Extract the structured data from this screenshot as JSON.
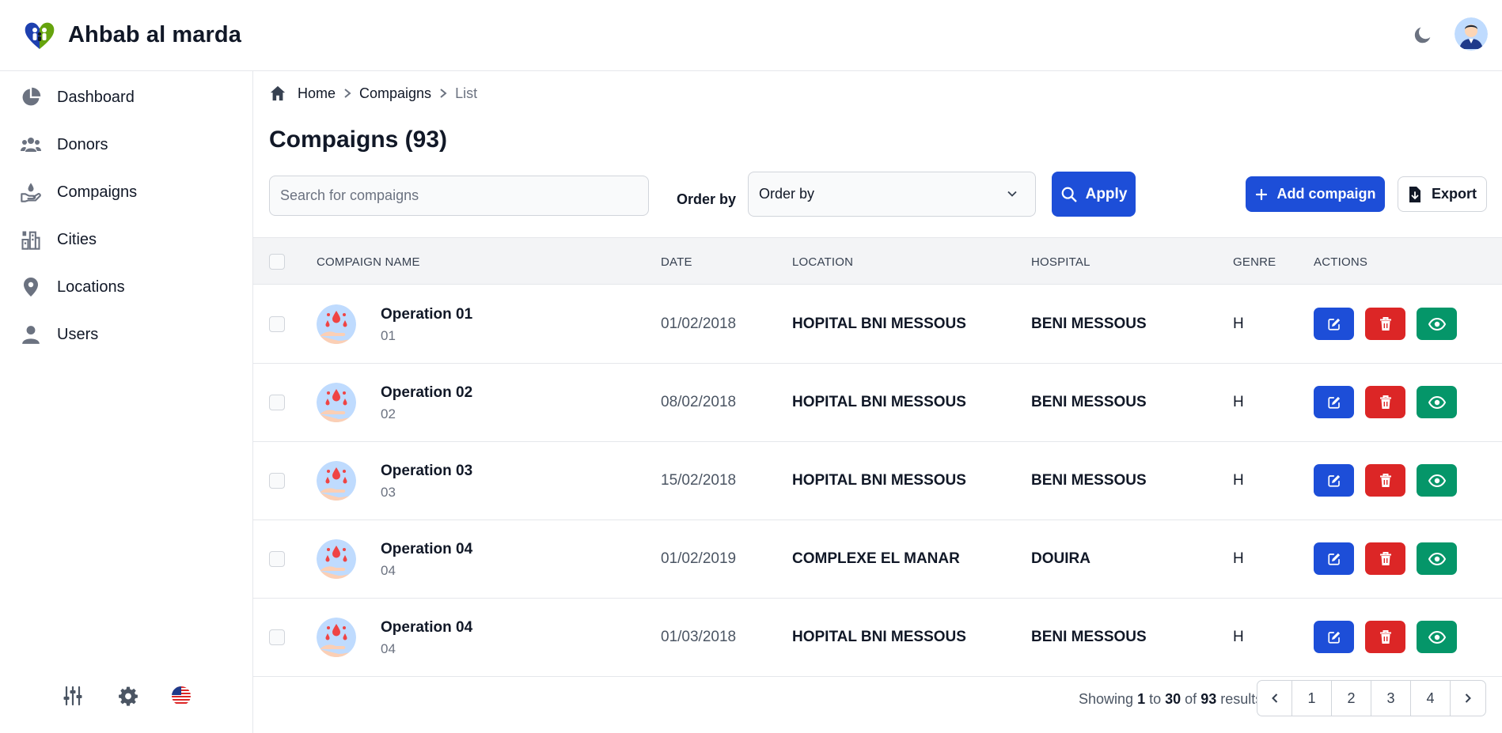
{
  "header": {
    "app_name": "Ahbab al marda"
  },
  "sidebar": {
    "items": [
      {
        "label": "Dashboard",
        "icon": "chart-pie-icon"
      },
      {
        "label": "Donors",
        "icon": "users-group-icon"
      },
      {
        "label": "Compaigns",
        "icon": "hand-drop-icon"
      },
      {
        "label": "Cities",
        "icon": "buildings-icon"
      },
      {
        "label": "Locations",
        "icon": "map-pin-icon"
      },
      {
        "label": "Users",
        "icon": "user-icon"
      }
    ],
    "bottom_icons": [
      "sliders-icon",
      "gear-icon",
      "us-flag-icon"
    ]
  },
  "breadcrumb": {
    "home": "Home",
    "section": "Compaigns",
    "current": "List"
  },
  "page": {
    "title": "Compaigns (93)"
  },
  "toolbar": {
    "search_placeholder": "Search for compaigns",
    "order_label": "Order by",
    "order_value": "Order by",
    "apply_label": "Apply",
    "add_label": "Add compaign",
    "export_label": "Export"
  },
  "table": {
    "headers": {
      "name": "COMPAIGN NAME",
      "date": "DATE",
      "location": "LOCATION",
      "hospital": "HOSPITAL",
      "genre": "GENRE",
      "actions": "ACTIONS"
    },
    "rows": [
      {
        "name": "Operation 01",
        "code": "01",
        "date": "01/02/2018",
        "location": "HOPITAL BNI MESSOUS",
        "hospital": "BENI MESSOUS",
        "genre": "H"
      },
      {
        "name": "Operation 02",
        "code": "02",
        "date": "08/02/2018",
        "location": "HOPITAL BNI MESSOUS",
        "hospital": "BENI MESSOUS",
        "genre": "H"
      },
      {
        "name": "Operation 03",
        "code": "03",
        "date": "15/02/2018",
        "location": "HOPITAL BNI MESSOUS",
        "hospital": "BENI MESSOUS",
        "genre": "H"
      },
      {
        "name": "Operation 04",
        "code": "04",
        "date": "01/02/2019",
        "location": "COMPLEXE EL MANAR",
        "hospital": "DOUIRA",
        "genre": "H"
      },
      {
        "name": "Operation 04",
        "code": "04",
        "date": "01/03/2018",
        "location": "HOPITAL BNI MESSOUS",
        "hospital": "BENI MESSOUS",
        "genre": "H"
      }
    ]
  },
  "pagination": {
    "showing_prefix": "Showing",
    "from": "1",
    "to_word": "to",
    "to": "30",
    "of_word": "of",
    "total": "93",
    "suffix": "results",
    "pages": [
      "1",
      "2",
      "3",
      "4"
    ]
  },
  "colors": {
    "primary": "#1d4ed8",
    "danger": "#dc2626",
    "success": "#059669",
    "border": "#e5e7eb",
    "header_bg": "#f3f4f6"
  }
}
